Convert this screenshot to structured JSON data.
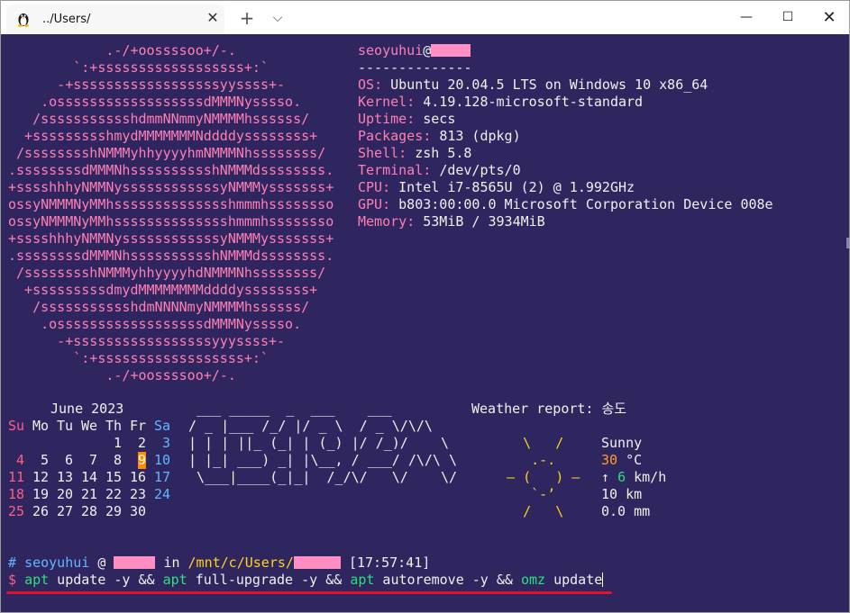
{
  "window": {
    "tab_title": "../Users/",
    "tab_close": "✕",
    "new_tab": "+",
    "dropdown": "⌵",
    "minimize": "—",
    "maximize": "☐",
    "close": "✕"
  },
  "neofetch": {
    "user": "seoyuhui",
    "at": "@",
    "separator": "--------------",
    "info": [
      {
        "key": "OS",
        "value": "Ubuntu 20.04.5 LTS on Windows 10 x86_64"
      },
      {
        "key": "Kernel",
        "value": "4.19.128-microsoft-standard"
      },
      {
        "key": "Uptime",
        "value": "secs"
      },
      {
        "key": "Packages",
        "value": "813 (dpkg)"
      },
      {
        "key": "Shell",
        "value": "zsh 5.8"
      },
      {
        "key": "Terminal",
        "value": "/dev/pts/0"
      },
      {
        "key": "CPU",
        "value": "Intel i7-8565U (2) @ 1.992GHz"
      },
      {
        "key": "GPU",
        "value": "b803:00:00.0 Microsoft Corporation Device 008e"
      },
      {
        "key": "Memory",
        "value": "53MiB / 3934MiB"
      }
    ],
    "logo": [
      "            .-/+oossssoo+/-.",
      "        `:+ssssssssssssssssss+:`",
      "      -+ssssssssssssssssssyyssss+-",
      "    .ossssssssssssssssssdMMMNysssso.",
      "   /ssssssssssshdmmNNmmyNMMMMhssssss/",
      "  +ssssssssshmydMMMMMMMNddddyssssssss+",
      " /sssssssshNMMMyhhyyyyhmNMMMNhssssssss/",
      ".ssssssssdMMMNhsssssssssshNMMMdssssssss.",
      "+sssshhhyNMMNyssssssssssssyNMMMysssssss+",
      "ossyNMMMNyMMhsssssssssssssshmmmhssssssso",
      "ossyNMMMNyMMhsssssssssssssshmmmhssssssso",
      "+sssshhhyNMMNyssssssssssssyNMMMysssssss+",
      ".ssssssssdMMMNhsssssssssshNMMMdssssssss.",
      " /sssssssshNMMMyhhyyyyhdNMMMNhssssssss/",
      "  +sssssssssdmydMMMMMMMMddddyssssssss+",
      "   /ssssssssssshdmNNNNmyNMMMMhssssss/",
      "    .ossssssssssssssssssdMMMNysssso.",
      "      -+sssssssssssssssssyyyssss+-",
      "        `:+ssssssssssssssssss+:`",
      "            .-/+oossssoo+/-."
    ]
  },
  "calendar": {
    "header": "June 2023",
    "weekdays": [
      "Su",
      "Mo",
      "Tu",
      "We",
      "Th",
      "Fr",
      "Sa"
    ],
    "weeks": [
      [
        "",
        "",
        "",
        "",
        "1",
        "2",
        "3"
      ],
      [
        "4",
        "5",
        "6",
        "7",
        "8",
        "9",
        "10"
      ],
      [
        "11",
        "12",
        "13",
        "14",
        "15",
        "16",
        "17"
      ],
      [
        "18",
        "19",
        "20",
        "21",
        "22",
        "23",
        "24"
      ],
      [
        "25",
        "26",
        "27",
        "28",
        "29",
        "30",
        ""
      ]
    ],
    "today": "9"
  },
  "ascii_banner": [
    " ___ _____  _  ___    ___",
    "/ _ |___ /_/ |/ _ \\  / _ \\/\\/\\",
    "| | | ||_ (_| | (_) |/ /_)/    \\",
    "| |_| ___) _| |\\__, / ___/ /\\/\\ \\",
    " \\___|____(_|_|  /_/\\/   \\/    \\/"
  ],
  "weather": {
    "label": "Weather report:",
    "location": "송도",
    "condition": "Sunny",
    "temp_value": "30",
    "temp_unit": "°C",
    "wind_arrow": "↑",
    "wind_value": "6",
    "wind_unit": "km/h",
    "visibility": "10 km",
    "precip": "0.0 mm",
    "sun_art": [
      "   \\   /",
      "    .-.",
      " ― (   ) ―",
      "    `-’",
      "   /   \\"
    ]
  },
  "prompt": {
    "hash": "#",
    "user": "seoyuhui",
    "at": "@",
    "in": "in",
    "path": "/mnt/c/Users/",
    "time": "[17:57:41]",
    "dollar": "$",
    "command": [
      {
        "text": "apt",
        "style": "grn"
      },
      {
        "text": " update -y && ",
        "style": "wht"
      },
      {
        "text": "apt",
        "style": "grn"
      },
      {
        "text": " full-upgrade -y && ",
        "style": "wht"
      },
      {
        "text": "apt",
        "style": "grn"
      },
      {
        "text": " autoremove -y && ",
        "style": "wht"
      },
      {
        "text": "omz",
        "style": "grn"
      },
      {
        "text": " update",
        "style": "wht"
      }
    ]
  }
}
